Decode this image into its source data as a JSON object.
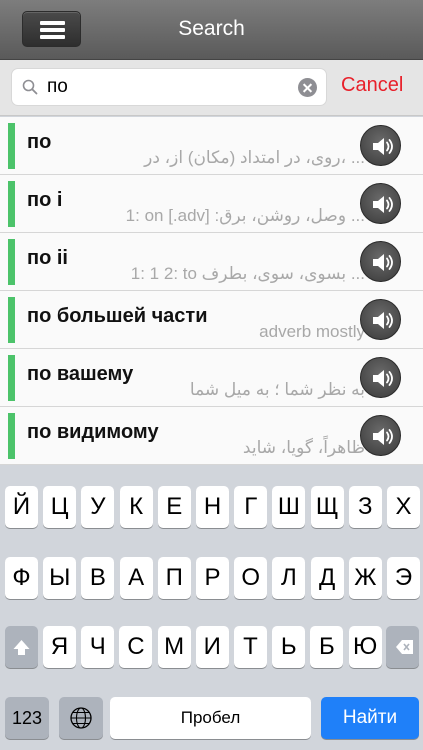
{
  "navbar": {
    "title": "Search"
  },
  "search": {
    "value": "по",
    "cancel_label": "Cancel"
  },
  "results": [
    {
      "word": "по",
      "translation": "روی، در امتداد (مکان) از، در، ..."
    },
    {
      "word": "по i",
      "translation": "1: on   [.adv] :وصل، روشن، برق ..."
    },
    {
      "word": "по ii",
      "translation": "1: 1  2: to    بسوی، سوی، بطرف ..."
    },
    {
      "word": "по большей части",
      "translation": "adverb    mostly"
    },
    {
      "word": "по вашему",
      "translation": "به نظر شما ؛ به میل شما"
    },
    {
      "word": "по видимому",
      "translation": "ظاهراً، گویا، شاید"
    }
  ],
  "keyboard": {
    "row1": [
      "Й",
      "Ц",
      "У",
      "К",
      "Е",
      "Н",
      "Г",
      "Ш",
      "Щ",
      "З",
      "Х"
    ],
    "row2": [
      "Ф",
      "Ы",
      "В",
      "А",
      "П",
      "Р",
      "О",
      "Л",
      "Д",
      "Ж",
      "Э"
    ],
    "row3": [
      "Я",
      "Ч",
      "С",
      "М",
      "И",
      "Т",
      "Ь",
      "Б",
      "Ю"
    ],
    "numbers_label": "123",
    "space_label": "Пробел",
    "return_label": "Найти"
  },
  "colors": {
    "accent_green": "#4cc36a",
    "cancel_red": "#e8202a",
    "return_blue": "#1f80f9"
  }
}
